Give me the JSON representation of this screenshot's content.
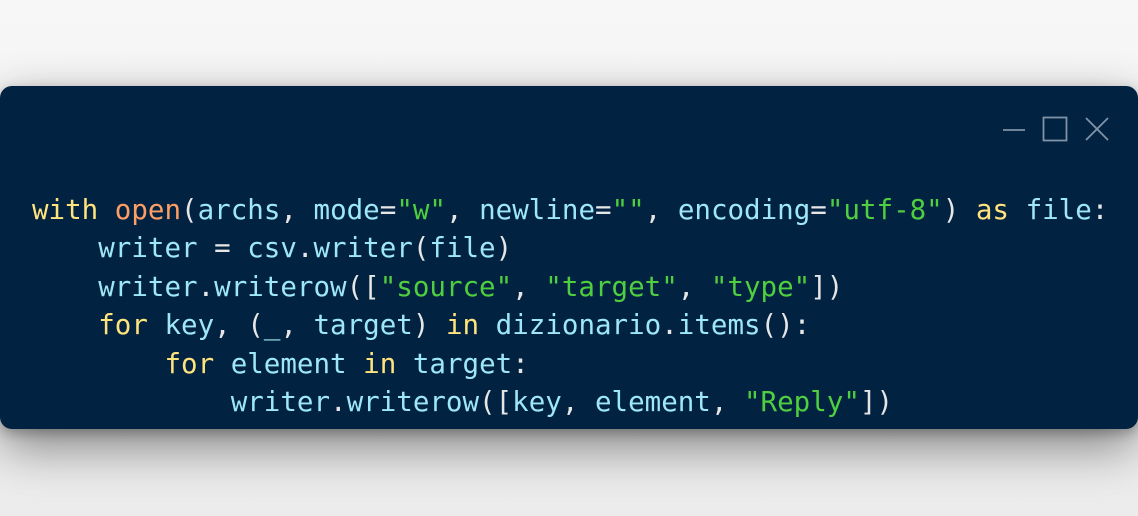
{
  "window": {
    "controls": [
      {
        "name": "minimize-button",
        "icon": "minimize-icon"
      },
      {
        "name": "maximize-button",
        "icon": "maximize-icon"
      },
      {
        "name": "close-button",
        "icon": "close-icon"
      }
    ],
    "colors": {
      "background": "#012241",
      "keyword": "#ffe37c",
      "builtin": "#ff9e64",
      "identifier": "#9ee7f7",
      "punctuation": "#e6e6e6",
      "string": "#4fcf3f"
    }
  },
  "code": {
    "lines": [
      [
        {
          "t": "with",
          "c": "kw"
        },
        {
          "t": " ",
          "c": "pu"
        },
        {
          "t": "open",
          "c": "bi"
        },
        {
          "t": "(",
          "c": "pu"
        },
        {
          "t": "archs",
          "c": "id"
        },
        {
          "t": ", ",
          "c": "pu"
        },
        {
          "t": "mode",
          "c": "id"
        },
        {
          "t": "=",
          "c": "pu"
        },
        {
          "t": "\"w\"",
          "c": "st"
        },
        {
          "t": ", ",
          "c": "pu"
        },
        {
          "t": "newline",
          "c": "id"
        },
        {
          "t": "=",
          "c": "pu"
        },
        {
          "t": "\"\"",
          "c": "st"
        },
        {
          "t": ", ",
          "c": "pu"
        },
        {
          "t": "encoding",
          "c": "id"
        },
        {
          "t": "=",
          "c": "pu"
        },
        {
          "t": "\"utf-8\"",
          "c": "st"
        },
        {
          "t": ") ",
          "c": "pu"
        },
        {
          "t": "as",
          "c": "kw"
        },
        {
          "t": " ",
          "c": "pu"
        },
        {
          "t": "file",
          "c": "id"
        },
        {
          "t": ":",
          "c": "pu"
        }
      ],
      [
        {
          "t": "    ",
          "c": "pu"
        },
        {
          "t": "writer",
          "c": "id"
        },
        {
          "t": " = ",
          "c": "pu"
        },
        {
          "t": "csv",
          "c": "id"
        },
        {
          "t": ".",
          "c": "pu"
        },
        {
          "t": "writer",
          "c": "id"
        },
        {
          "t": "(",
          "c": "pu"
        },
        {
          "t": "file",
          "c": "id"
        },
        {
          "t": ")",
          "c": "pu"
        }
      ],
      [
        {
          "t": "    ",
          "c": "pu"
        },
        {
          "t": "writer",
          "c": "id"
        },
        {
          "t": ".",
          "c": "pu"
        },
        {
          "t": "writerow",
          "c": "id"
        },
        {
          "t": "([",
          "c": "pu"
        },
        {
          "t": "\"source\"",
          "c": "st"
        },
        {
          "t": ", ",
          "c": "pu"
        },
        {
          "t": "\"target\"",
          "c": "st"
        },
        {
          "t": ", ",
          "c": "pu"
        },
        {
          "t": "\"type\"",
          "c": "st"
        },
        {
          "t": "])",
          "c": "pu"
        }
      ],
      [
        {
          "t": "    ",
          "c": "pu"
        },
        {
          "t": "for",
          "c": "kw"
        },
        {
          "t": " ",
          "c": "pu"
        },
        {
          "t": "key",
          "c": "id"
        },
        {
          "t": ", (",
          "c": "pu"
        },
        {
          "t": "_",
          "c": "id"
        },
        {
          "t": ", ",
          "c": "pu"
        },
        {
          "t": "target",
          "c": "id"
        },
        {
          "t": ") ",
          "c": "pu"
        },
        {
          "t": "in",
          "c": "kw"
        },
        {
          "t": " ",
          "c": "pu"
        },
        {
          "t": "dizionario",
          "c": "id"
        },
        {
          "t": ".",
          "c": "pu"
        },
        {
          "t": "items",
          "c": "id"
        },
        {
          "t": "():",
          "c": "pu"
        }
      ],
      [
        {
          "t": "        ",
          "c": "pu"
        },
        {
          "t": "for",
          "c": "kw"
        },
        {
          "t": " ",
          "c": "pu"
        },
        {
          "t": "element",
          "c": "id"
        },
        {
          "t": " ",
          "c": "pu"
        },
        {
          "t": "in",
          "c": "kw"
        },
        {
          "t": " ",
          "c": "pu"
        },
        {
          "t": "target",
          "c": "id"
        },
        {
          "t": ":",
          "c": "pu"
        }
      ],
      [
        {
          "t": "            ",
          "c": "pu"
        },
        {
          "t": "writer",
          "c": "id"
        },
        {
          "t": ".",
          "c": "pu"
        },
        {
          "t": "writerow",
          "c": "id"
        },
        {
          "t": "([",
          "c": "pu"
        },
        {
          "t": "key",
          "c": "id"
        },
        {
          "t": ", ",
          "c": "pu"
        },
        {
          "t": "element",
          "c": "id"
        },
        {
          "t": ", ",
          "c": "pu"
        },
        {
          "t": "\"Reply\"",
          "c": "st"
        },
        {
          "t": "])",
          "c": "pu"
        }
      ]
    ]
  }
}
